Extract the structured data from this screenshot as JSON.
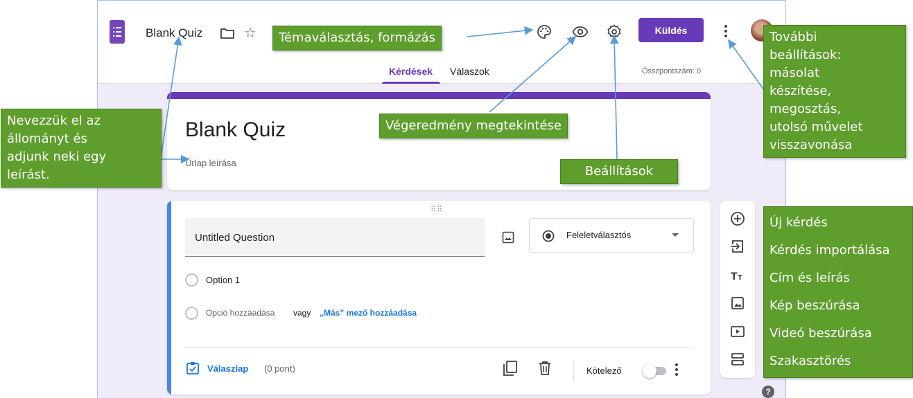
{
  "app": {
    "doc_title": "Blank Quiz",
    "send_label": "Küldés",
    "tabs": [
      {
        "label": "Kérdések"
      },
      {
        "label": "Válaszok"
      }
    ],
    "total_points": "Összpontszám: 0",
    "accent_color": "#673ab7"
  },
  "form": {
    "title": "Blank Quiz",
    "description": "Űrlap leírása"
  },
  "question": {
    "title_value": "Untitled Question",
    "type_label": "Feleletválasztós",
    "option1": "Option 1",
    "add_option": "Opció hozzáadása",
    "or_label": "vagy",
    "add_other": "„Más” mező hozzáadása",
    "answer_key": "Válaszlap",
    "points": "(0 pont)",
    "required_label": "Kötelező",
    "required_on": false
  },
  "sidebar_tools": [
    {
      "icon": "add-circle-icon"
    },
    {
      "icon": "import-icon"
    },
    {
      "icon": "title-text-icon"
    },
    {
      "icon": "image-icon"
    },
    {
      "icon": "video-icon"
    },
    {
      "icon": "section-icon"
    }
  ],
  "annotations": {
    "theme": "Témaválasztás, formázás",
    "rename": [
      "Nevezzük el az",
      "állományt és",
      "adjunk neki egy",
      "leírást."
    ],
    "preview": "Végeredmény megtekintése",
    "settings": "Beállítások",
    "more": [
      "További",
      "beállítások:",
      "másolat",
      "készítése,",
      "megosztás,",
      "utolsó művelet",
      "visszavonása"
    ],
    "tools": [
      "Új kérdés",
      "Kérdés importálása",
      "Cím és leírás",
      "Kép beszúrása",
      "Videó beszúrása",
      "Szakasztörés"
    ],
    "color": "#5e9e2c"
  }
}
